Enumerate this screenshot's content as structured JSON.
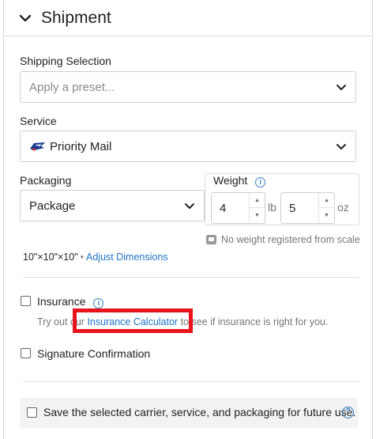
{
  "header": {
    "title": "Shipment",
    "icon": "chevron-down-icon"
  },
  "shipping_selection": {
    "label": "Shipping Selection",
    "placeholder": "Apply a preset..."
  },
  "service": {
    "label": "Service",
    "value": "Priority Mail",
    "icon": "usps-eagle-icon"
  },
  "packaging": {
    "label": "Packaging",
    "value": "Package"
  },
  "weight": {
    "label": "Weight",
    "lb_value": "4",
    "lb_unit": "lb",
    "oz_value": "5",
    "oz_unit": "oz",
    "scale_note": "No weight registered from scale"
  },
  "dimensions": {
    "value": "10\"×10\"×10\"",
    "separator": "•",
    "link": "Adjust Dimensions"
  },
  "insurance": {
    "label": "Insurance",
    "hint_prefix": "Try out our ",
    "hint_link": "Insurance Calculator",
    "hint_suffix": " to see if insurance is right for you."
  },
  "signature": {
    "label": "Signature Confirmation"
  },
  "save_preset": {
    "label": "Save the selected carrier, service, and packaging for future use."
  },
  "colors": {
    "link": "#1f74c4",
    "highlight": "#e8131b",
    "info": "#3b83c6"
  }
}
